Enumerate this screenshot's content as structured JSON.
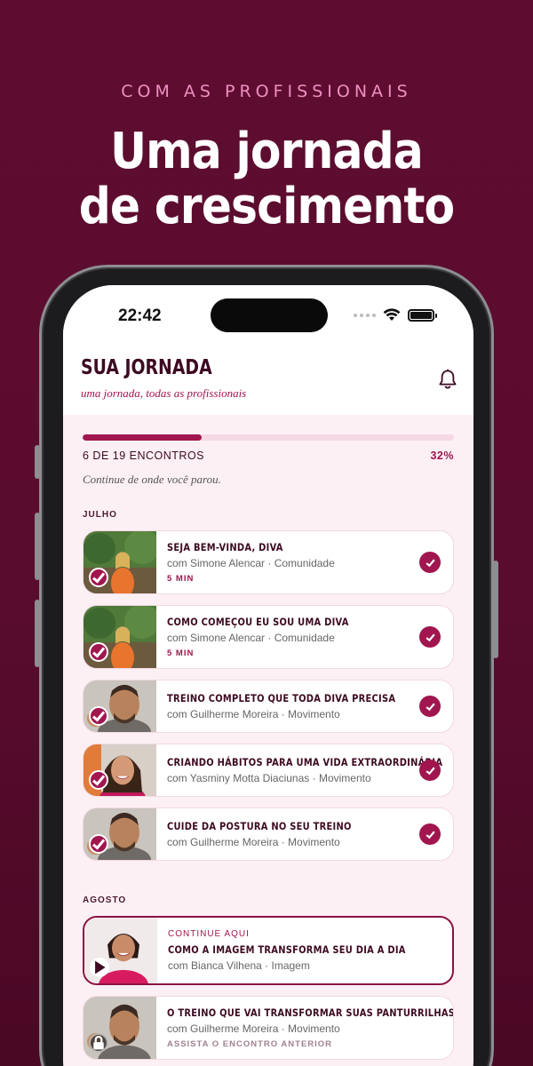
{
  "hero": {
    "kicker": "COM AS PROFISSIONAIS",
    "headline_line1": "Uma jornada",
    "headline_line2": "de crescimento"
  },
  "status_bar": {
    "time": "22:42",
    "icons": [
      "signal-dots-icon",
      "wifi-icon",
      "battery-icon"
    ]
  },
  "app": {
    "title": "SUA JORNADA",
    "subtitle": "uma jornada, todas as profissionais",
    "header_icon": "bell-icon"
  },
  "progress": {
    "label": "6 DE 19 ENCONTROS",
    "percent_label": "32%",
    "fraction": 0.32,
    "continue_text": "Continue de onde você parou."
  },
  "months": [
    {
      "name": "JULHO",
      "items": [
        {
          "title": "SEJA BEM-VINDA, DIVA",
          "meta": "com Simone Alencar · Comunidade",
          "duration": "5 MIN",
          "status": "done"
        },
        {
          "title": "COMO COMEÇOU EU SOU UMA DIVA",
          "meta": "com Simone Alencar · Comunidade",
          "duration": "5 MIN",
          "status": "done"
        },
        {
          "title": "TREINO COMPLETO QUE TODA DIVA PRECISA",
          "meta": "com Guilherme Moreira · Movimento",
          "status": "done"
        },
        {
          "title": "CRIANDO HÁBITOS PARA UMA VIDA EXTRAORDINÁRIA",
          "meta": "com Yasminy Motta Diaciunas · Movimento",
          "status": "done"
        },
        {
          "title": "CUIDE DA POSTURA NO SEU TREINO",
          "meta": "com Guilherme Moreira · Movimento",
          "status": "done"
        }
      ]
    },
    {
      "name": "AGOSTO",
      "items": [
        {
          "kicker": "CONTINUE AQUI",
          "title": "COMO A IMAGEM TRANSFORMA SEU DIA A DIA",
          "meta": "com Bianca Vilhena · Imagem",
          "status": "current"
        },
        {
          "title": "O TREINO QUE VAI TRANSFORMAR SUAS PANTURRILHAS",
          "meta": "com Guilherme Moreira · Movimento",
          "note": "ASSISTA O ENCONTRO ANTERIOR",
          "status": "locked"
        }
      ]
    }
  ],
  "colors": {
    "background": "#5e0d30",
    "accent": "#a1164f",
    "kicker": "#ef8fc0",
    "screen_bg": "#fdf0f5"
  }
}
